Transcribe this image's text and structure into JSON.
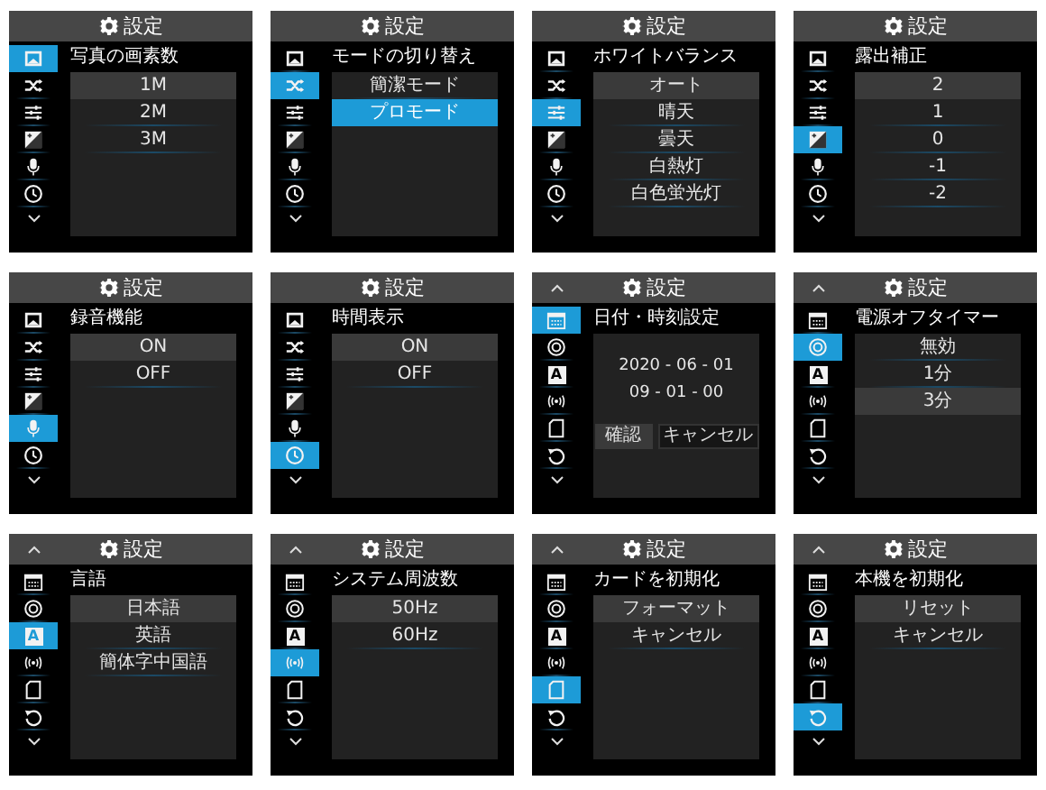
{
  "screens": [
    {
      "header": {
        "title": "設定",
        "scroll_up": false
      },
      "sidebar": [
        {
          "kind": "photo",
          "selected": true
        },
        {
          "kind": "shuffle",
          "selected": false
        },
        {
          "kind": "sliders",
          "selected": false
        },
        {
          "kind": "exposure",
          "selected": false
        },
        {
          "kind": "mic",
          "selected": false
        },
        {
          "kind": "clock",
          "selected": false
        }
      ],
      "title": "写真の画素数",
      "content": {
        "kind": "list",
        "options": [
          {
            "label": "1M",
            "selected": true,
            "focused": false
          },
          {
            "label": "2M",
            "selected": false,
            "focused": false
          },
          {
            "label": "3M",
            "selected": false,
            "focused": false
          }
        ]
      }
    },
    {
      "header": {
        "title": "設定",
        "scroll_up": false
      },
      "sidebar": [
        {
          "kind": "photo",
          "selected": false
        },
        {
          "kind": "shuffle",
          "selected": true
        },
        {
          "kind": "sliders",
          "selected": false
        },
        {
          "kind": "exposure",
          "selected": false
        },
        {
          "kind": "mic",
          "selected": false
        },
        {
          "kind": "clock",
          "selected": false
        }
      ],
      "title": "モードの切り替え",
      "content": {
        "kind": "list",
        "options": [
          {
            "label": "簡潔モード",
            "selected": false,
            "focused": false
          },
          {
            "label": "プロモード",
            "selected": false,
            "focused": true
          }
        ]
      }
    },
    {
      "header": {
        "title": "設定",
        "scroll_up": false
      },
      "sidebar": [
        {
          "kind": "photo",
          "selected": false
        },
        {
          "kind": "shuffle",
          "selected": false
        },
        {
          "kind": "sliders",
          "selected": true
        },
        {
          "kind": "exposure",
          "selected": false
        },
        {
          "kind": "mic",
          "selected": false
        },
        {
          "kind": "clock",
          "selected": false
        }
      ],
      "title": "ホワイトバランス",
      "content": {
        "kind": "list",
        "options": [
          {
            "label": "オート",
            "selected": true,
            "focused": false
          },
          {
            "label": "晴天",
            "selected": false,
            "focused": false
          },
          {
            "label": "曇天",
            "selected": false,
            "focused": false
          },
          {
            "label": "白熱灯",
            "selected": false,
            "focused": false
          },
          {
            "label": "白色蛍光灯",
            "selected": false,
            "focused": false
          }
        ]
      }
    },
    {
      "header": {
        "title": "設定",
        "scroll_up": false
      },
      "sidebar": [
        {
          "kind": "photo",
          "selected": false
        },
        {
          "kind": "shuffle",
          "selected": false
        },
        {
          "kind": "sliders",
          "selected": false
        },
        {
          "kind": "exposure",
          "selected": true
        },
        {
          "kind": "mic",
          "selected": false
        },
        {
          "kind": "clock",
          "selected": false
        }
      ],
      "title": "露出補正",
      "content": {
        "kind": "list",
        "options": [
          {
            "label": "2",
            "selected": true,
            "focused": false
          },
          {
            "label": "1",
            "selected": false,
            "focused": false
          },
          {
            "label": "0",
            "selected": false,
            "focused": false
          },
          {
            "label": "-1",
            "selected": false,
            "focused": false
          },
          {
            "label": "-2",
            "selected": false,
            "focused": false
          }
        ]
      }
    },
    {
      "header": {
        "title": "設定",
        "scroll_up": false
      },
      "sidebar": [
        {
          "kind": "photo",
          "selected": false
        },
        {
          "kind": "shuffle",
          "selected": false
        },
        {
          "kind": "sliders",
          "selected": false
        },
        {
          "kind": "exposure",
          "selected": false
        },
        {
          "kind": "mic",
          "selected": true
        },
        {
          "kind": "clock",
          "selected": false
        }
      ],
      "title": "録音機能",
      "content": {
        "kind": "list",
        "options": [
          {
            "label": "ON",
            "selected": true,
            "focused": false
          },
          {
            "label": "OFF",
            "selected": false,
            "focused": false
          }
        ]
      }
    },
    {
      "header": {
        "title": "設定",
        "scroll_up": false
      },
      "sidebar": [
        {
          "kind": "photo",
          "selected": false
        },
        {
          "kind": "shuffle",
          "selected": false
        },
        {
          "kind": "sliders",
          "selected": false
        },
        {
          "kind": "exposure",
          "selected": false
        },
        {
          "kind": "mic",
          "selected": false
        },
        {
          "kind": "clock",
          "selected": true
        }
      ],
      "title": "時間表示",
      "content": {
        "kind": "list",
        "options": [
          {
            "label": "ON",
            "selected": true,
            "focused": false
          },
          {
            "label": "OFF",
            "selected": false,
            "focused": false
          }
        ]
      }
    },
    {
      "header": {
        "title": "設定",
        "scroll_up": true
      },
      "sidebar": [
        {
          "kind": "calendar",
          "selected": true
        },
        {
          "kind": "target",
          "selected": false
        },
        {
          "kind": "language",
          "glyph": "A",
          "selected": false
        },
        {
          "kind": "wireless",
          "selected": false
        },
        {
          "kind": "card",
          "selected": false
        },
        {
          "kind": "reset",
          "selected": false
        }
      ],
      "title": "日付・時刻設定",
      "content": {
        "kind": "datetime",
        "date": "2020 - 06 - 01",
        "time": "09 - 01 - 00",
        "buttons": [
          {
            "label": "確認",
            "selected": true
          },
          {
            "label": "キャンセル",
            "selected": false
          }
        ]
      }
    },
    {
      "header": {
        "title": "設定",
        "scroll_up": true
      },
      "sidebar": [
        {
          "kind": "calendar",
          "selected": false
        },
        {
          "kind": "target",
          "selected": true
        },
        {
          "kind": "language",
          "glyph": "A",
          "selected": false
        },
        {
          "kind": "wireless",
          "selected": false
        },
        {
          "kind": "card",
          "selected": false
        },
        {
          "kind": "reset",
          "selected": false
        }
      ],
      "title": "電源オフタイマー",
      "content": {
        "kind": "list",
        "options": [
          {
            "label": "無効",
            "selected": false,
            "focused": false
          },
          {
            "label": "1分",
            "selected": false,
            "focused": false
          },
          {
            "label": "3分",
            "selected": true,
            "focused": false
          }
        ]
      }
    },
    {
      "header": {
        "title": "設定",
        "scroll_up": true
      },
      "sidebar": [
        {
          "kind": "calendar",
          "selected": false
        },
        {
          "kind": "target",
          "selected": false
        },
        {
          "kind": "language",
          "glyph": "A",
          "selected": true
        },
        {
          "kind": "wireless",
          "selected": false
        },
        {
          "kind": "card",
          "selected": false
        },
        {
          "kind": "reset",
          "selected": false
        }
      ],
      "title": "言語",
      "content": {
        "kind": "list",
        "options": [
          {
            "label": "日本語",
            "selected": true,
            "focused": false
          },
          {
            "label": "英語",
            "selected": false,
            "focused": false
          },
          {
            "label": "簡体字中国語",
            "selected": false,
            "focused": false
          }
        ]
      }
    },
    {
      "header": {
        "title": "設定",
        "scroll_up": true
      },
      "sidebar": [
        {
          "kind": "calendar",
          "selected": false
        },
        {
          "kind": "target",
          "selected": false
        },
        {
          "kind": "language",
          "glyph": "A",
          "selected": false
        },
        {
          "kind": "wireless",
          "selected": true
        },
        {
          "kind": "card",
          "selected": false
        },
        {
          "kind": "reset",
          "selected": false
        }
      ],
      "title": "システム周波数",
      "content": {
        "kind": "list",
        "options": [
          {
            "label": "50Hz",
            "selected": true,
            "focused": false
          },
          {
            "label": "60Hz",
            "selected": false,
            "focused": false
          }
        ]
      }
    },
    {
      "header": {
        "title": "設定",
        "scroll_up": true
      },
      "sidebar": [
        {
          "kind": "calendar",
          "selected": false
        },
        {
          "kind": "target",
          "selected": false
        },
        {
          "kind": "language",
          "glyph": "A",
          "selected": false
        },
        {
          "kind": "wireless",
          "selected": false
        },
        {
          "kind": "card",
          "selected": true
        },
        {
          "kind": "reset",
          "selected": false
        }
      ],
      "title": "カードを初期化",
      "content": {
        "kind": "list",
        "options": [
          {
            "label": "フォーマット",
            "selected": true,
            "focused": false
          },
          {
            "label": "キャンセル",
            "selected": false,
            "focused": false
          }
        ]
      }
    },
    {
      "header": {
        "title": "設定",
        "scroll_up": true
      },
      "sidebar": [
        {
          "kind": "calendar",
          "selected": false
        },
        {
          "kind": "target",
          "selected": false
        },
        {
          "kind": "language",
          "glyph": "A",
          "selected": false
        },
        {
          "kind": "wireless",
          "selected": false
        },
        {
          "kind": "card",
          "selected": false
        },
        {
          "kind": "reset",
          "selected": true
        }
      ],
      "title": "本機を初期化",
      "content": {
        "kind": "list",
        "options": [
          {
            "label": "リセット",
            "selected": true,
            "focused": false
          },
          {
            "label": "キャンセル",
            "selected": false,
            "focused": false
          }
        ]
      }
    }
  ]
}
